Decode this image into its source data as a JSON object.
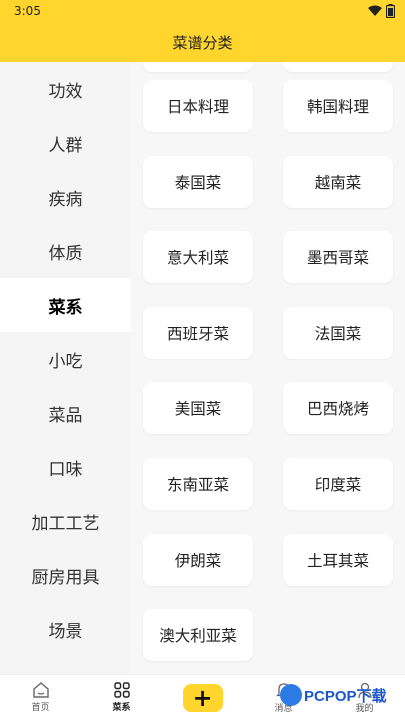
{
  "status": {
    "time": "3:05"
  },
  "header": {
    "title": "菜谱分类"
  },
  "sidebar": {
    "items": [
      {
        "label": "功效"
      },
      {
        "label": "人群"
      },
      {
        "label": "疾病"
      },
      {
        "label": "体质"
      },
      {
        "label": "菜系",
        "active": true
      },
      {
        "label": "小吃"
      },
      {
        "label": "菜品"
      },
      {
        "label": "口味"
      },
      {
        "label": "加工工艺"
      },
      {
        "label": "厨房用具"
      },
      {
        "label": "场景"
      }
    ]
  },
  "content": {
    "cards": [
      {
        "label": "日本料理"
      },
      {
        "label": "韩国料理"
      },
      {
        "label": "泰国菜"
      },
      {
        "label": "越南菜"
      },
      {
        "label": "意大利菜"
      },
      {
        "label": "墨西哥菜"
      },
      {
        "label": "西班牙菜"
      },
      {
        "label": "法国菜"
      },
      {
        "label": "美国菜"
      },
      {
        "label": "巴西烧烤"
      },
      {
        "label": "东南亚菜"
      },
      {
        "label": "印度菜"
      },
      {
        "label": "伊朗菜"
      },
      {
        "label": "土耳其菜"
      },
      {
        "label": "澳大利亚菜"
      }
    ]
  },
  "bottom_nav": {
    "home": "首页",
    "recipes": "菜系",
    "add": "+",
    "messages": "消息",
    "mine": "我的"
  },
  "watermark": {
    "text": "PCPOP下载"
  },
  "colors": {
    "accent": "#FFD52E",
    "sidebar_bg": "#F5F5F5",
    "content_bg": "#F7F7F7"
  }
}
